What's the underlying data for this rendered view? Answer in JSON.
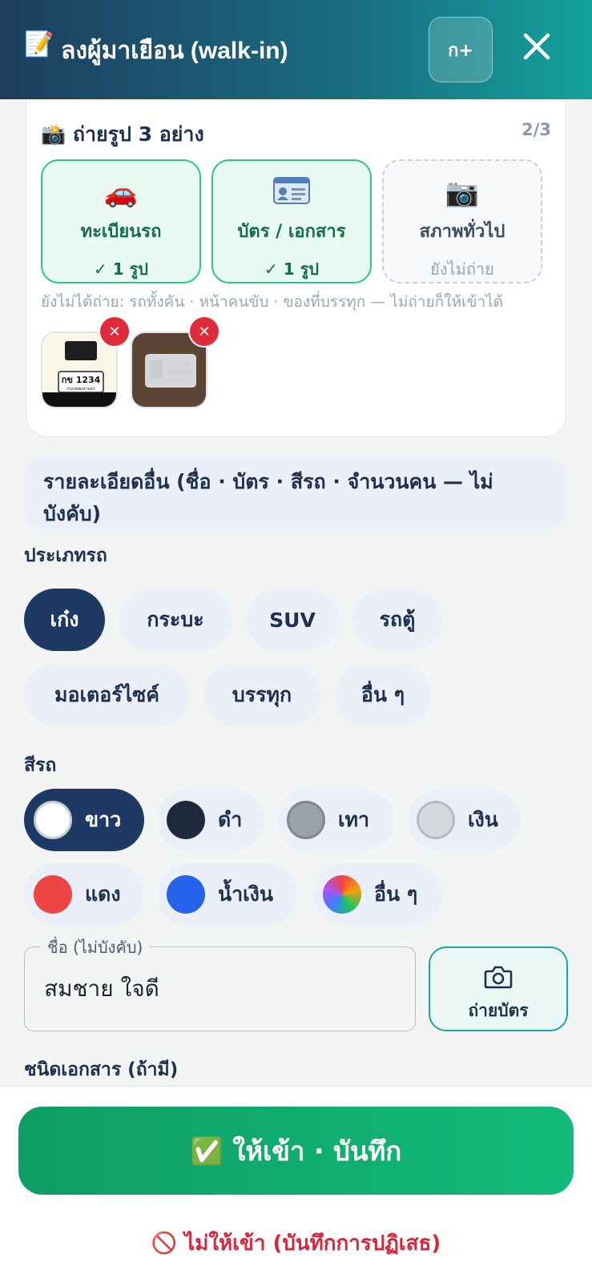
{
  "header": {
    "title_emoji": "📝",
    "title": "ลงผู้มาเยือน (walk-in)",
    "font_size_button": "ก+"
  },
  "photos": {
    "title": "📸 ถ่ายรูป 3 อย่าง",
    "count": "2/3",
    "tiles": [
      {
        "icon": "🚗",
        "label": "ทะเบียนรถ",
        "status": "✓ 1 รูป",
        "done": true
      },
      {
        "icon": "🪪",
        "label": "บัตร / เอกสาร",
        "status": "✓ 1 รูป",
        "done": true
      },
      {
        "icon": "📷",
        "label": "สภาพทั่วไป",
        "status": "ยังไม่ถ่าย",
        "done": false
      }
    ],
    "hint": "ยังไม่ได้ถ่าย: รถทั้งคัน · หน้าคนขับ · ของที่บรรทุก — ไม่ถ่ายก็ให้เข้าได้",
    "thumbnails": [
      {
        "plate_text": "กข 1234",
        "plate_province": "กรุงเทพมหานคร"
      },
      {
        "kind": "id-card-photo"
      }
    ]
  },
  "details_toggle": "รายละเอียดอื่น (ชื่อ · บัตร · สีรถ · จำนวนคน — ไม่บังคับ)",
  "vehicle_type": {
    "label": "ประเภทรถ",
    "options": [
      "เก๋ง",
      "กระบะ",
      "SUV",
      "รถตู้",
      "มอเตอร์ไซค์",
      "บรรทุก",
      "อื่น ๆ"
    ],
    "selected": "เก๋ง"
  },
  "vehicle_color": {
    "label": "สีรถ",
    "options": [
      {
        "name": "ขาว",
        "color": "#ffffff"
      },
      {
        "name": "ดำ",
        "color": "#1e293b"
      },
      {
        "name": "เทา",
        "color": "#9aa1ab"
      },
      {
        "name": "เงิน",
        "color": "#d4d7dc"
      },
      {
        "name": "แดง",
        "color": "#ef4444"
      },
      {
        "name": "น้ำเงิน",
        "color": "#2563eb"
      },
      {
        "name": "อื่น ๆ",
        "color": "multicolor"
      }
    ],
    "selected": "ขาว"
  },
  "name_field": {
    "legend": "ชื่อ (ไม่บังคับ)",
    "value": "สมชาย ใจดี"
  },
  "scan_card_button": {
    "icon": "camera-icon",
    "label": "ถ่ายบัตร"
  },
  "document_type": {
    "label": "ชนิดเอกสาร (ถ้ามี)"
  },
  "actions": {
    "save": "✅ ให้เข้า · บันทึก",
    "deny": "🚫 ไม่ให้เข้า (บันทึกการปฏิเสธ)"
  }
}
